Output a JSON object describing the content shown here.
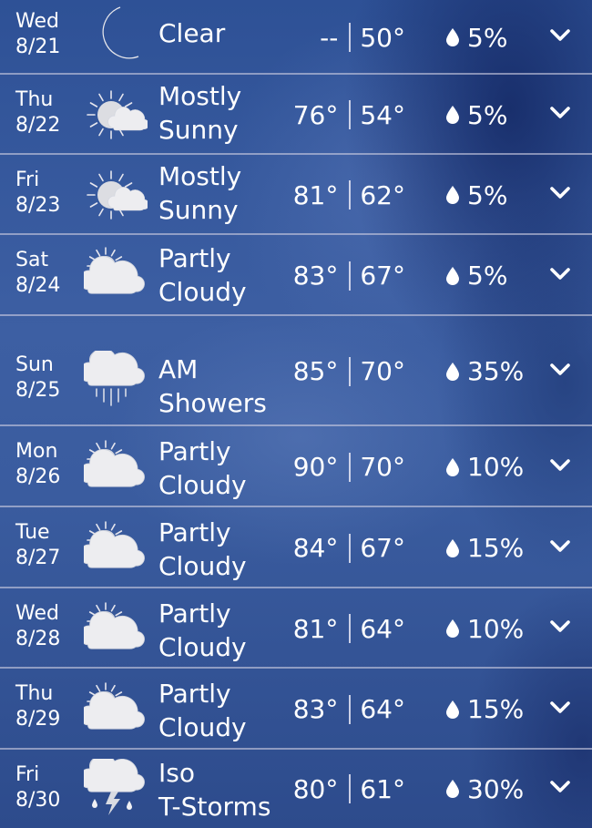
{
  "forecast": [
    {
      "weekday": "Wed",
      "date": "8/21",
      "icon": "moon-icon",
      "condition_line1": "Clear",
      "condition_line2": "",
      "high": "--",
      "low": "50°",
      "precip": "5%"
    },
    {
      "weekday": "Thu",
      "date": "8/22",
      "icon": "mostly-sunny-icon",
      "condition_line1": "Mostly",
      "condition_line2": "Sunny",
      "high": "76°",
      "low": "54°",
      "precip": "5%"
    },
    {
      "weekday": "Fri",
      "date": "8/23",
      "icon": "mostly-sunny-icon",
      "condition_line1": "Mostly",
      "condition_line2": "Sunny",
      "high": "81°",
      "low": "62°",
      "precip": "5%"
    },
    {
      "weekday": "Sat",
      "date": "8/24",
      "icon": "partly-cloudy-icon",
      "condition_line1": "Partly",
      "condition_line2": "Cloudy",
      "high": "83°",
      "low": "67°",
      "precip": "5%"
    },
    {
      "weekday": "Sun",
      "date": "8/25",
      "icon": "showers-icon",
      "condition_line1": "AM",
      "condition_line2": "Showers",
      "high": "85°",
      "low": "70°",
      "precip": "35%"
    },
    {
      "weekday": "Mon",
      "date": "8/26",
      "icon": "partly-cloudy-icon",
      "condition_line1": "Partly",
      "condition_line2": "Cloudy",
      "high": "90°",
      "low": "70°",
      "precip": "10%"
    },
    {
      "weekday": "Tue",
      "date": "8/27",
      "icon": "partly-cloudy-icon",
      "condition_line1": "Partly",
      "condition_line2": "Cloudy",
      "high": "84°",
      "low": "67°",
      "precip": "15%"
    },
    {
      "weekday": "Wed",
      "date": "8/28",
      "icon": "partly-cloudy-icon",
      "condition_line1": "Partly",
      "condition_line2": "Cloudy",
      "high": "81°",
      "low": "64°",
      "precip": "10%"
    },
    {
      "weekday": "Thu",
      "date": "8/29",
      "icon": "partly-cloudy-icon",
      "condition_line1": "Partly",
      "condition_line2": "Cloudy",
      "high": "83°",
      "low": "64°",
      "precip": "15%"
    },
    {
      "weekday": "Fri",
      "date": "8/30",
      "icon": "thunderstorm-icon",
      "condition_line1": "Iso",
      "condition_line2": "T-Storms",
      "high": "80°",
      "low": "61°",
      "precip": "30%"
    }
  ],
  "colors": {
    "text": "#ffffff",
    "divider": "#cdcde1",
    "icon_fill": "#ededf0",
    "moon_fill": "#c9c9cc"
  }
}
